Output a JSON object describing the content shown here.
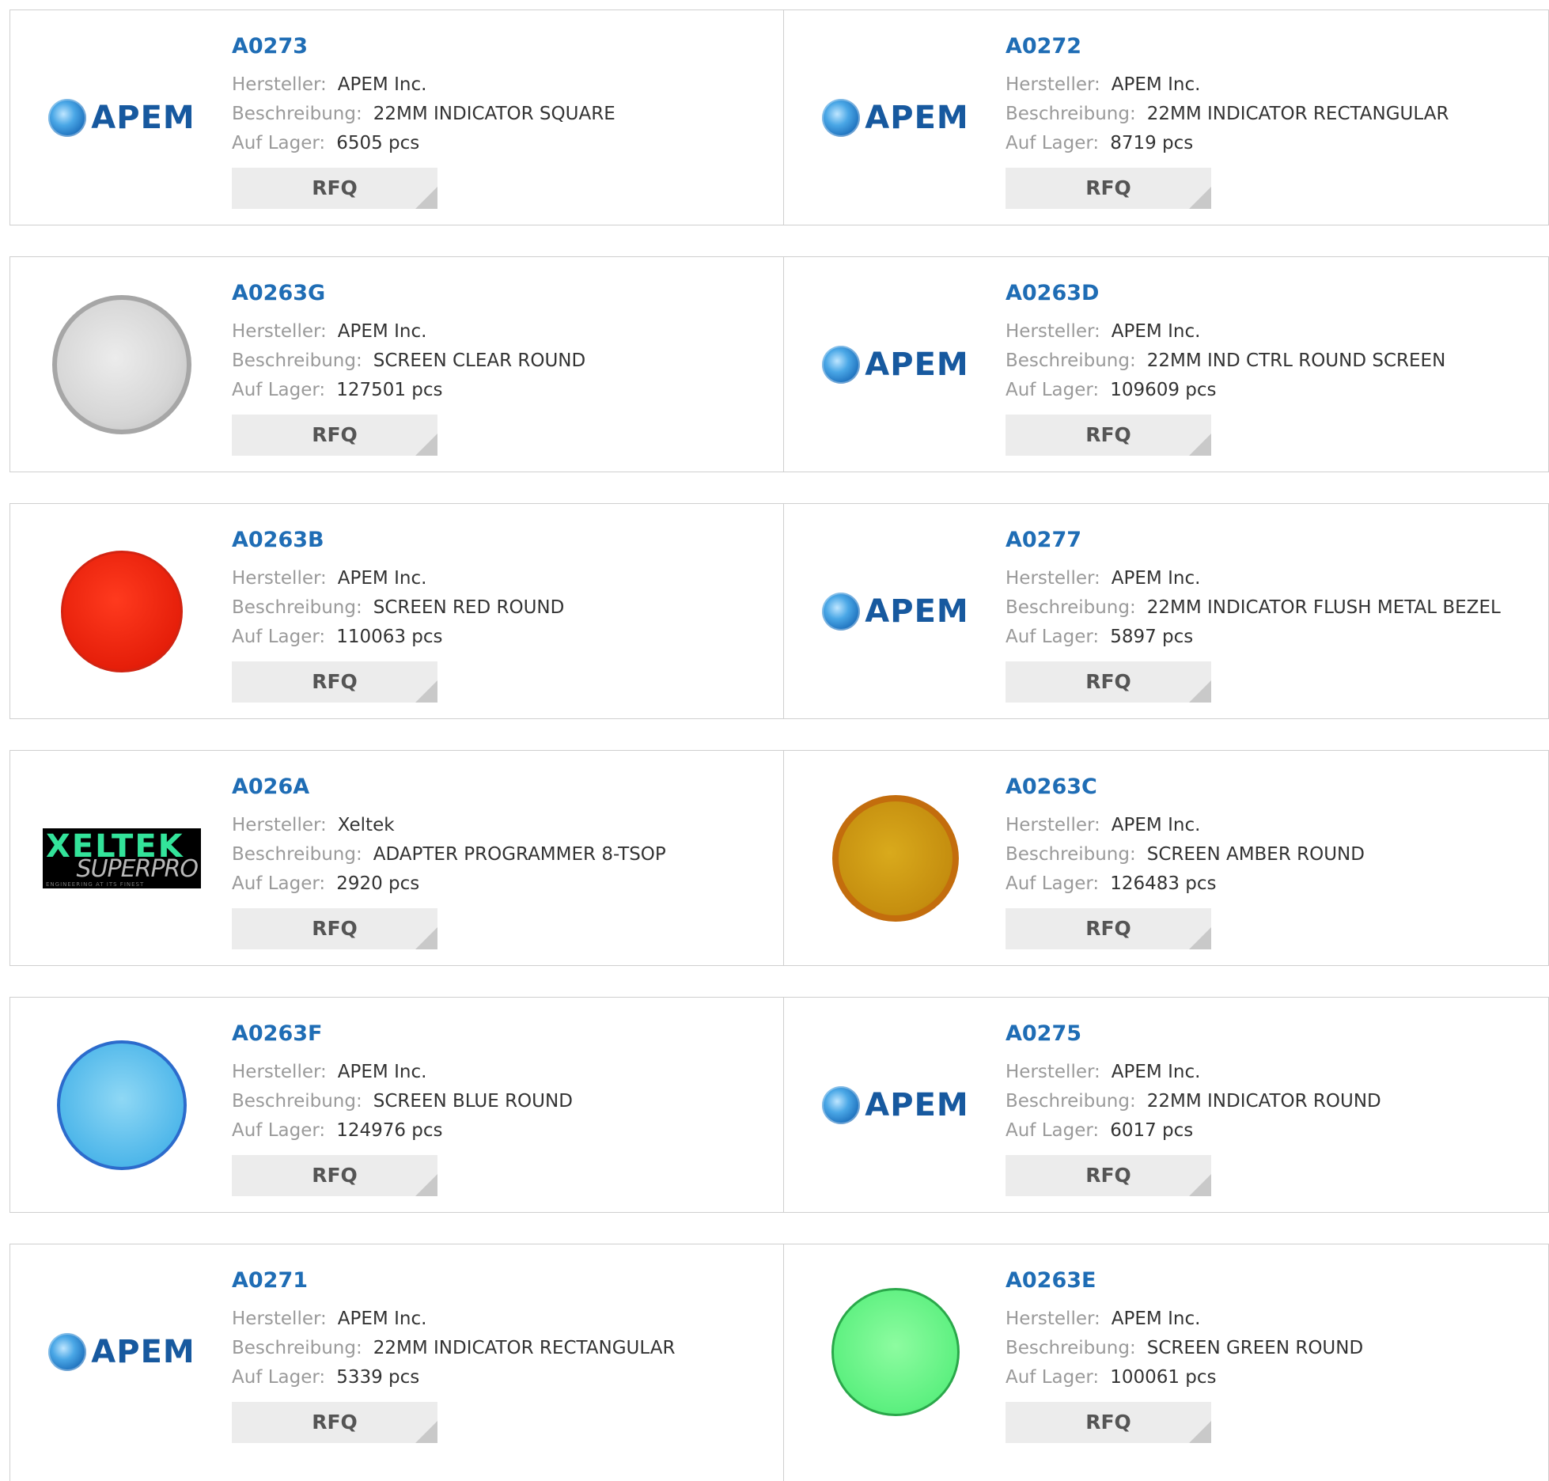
{
  "labels": {
    "manufacturer": "Hersteller:",
    "description": "Beschreibung:",
    "stock": "Auf Lager:",
    "rfq": "RFQ"
  },
  "brands": {
    "apem": "APEM",
    "xeltek_main": "XELTEK",
    "xeltek_sub": "SUPERPRO",
    "xeltek_tag": "ENGINEERING AT ITS FINEST"
  },
  "products": [
    {
      "part": "A0273",
      "manufacturer": "APEM Inc.",
      "description": "22MM INDICATOR SQUARE",
      "stock": "6505 pcs",
      "image": "apem-logo"
    },
    {
      "part": "A0272",
      "manufacturer": "APEM Inc.",
      "description": "22MM INDICATOR RECTANGULAR",
      "stock": "8719 pcs",
      "image": "apem-logo"
    },
    {
      "part": "A0263G",
      "manufacturer": "APEM Inc.",
      "description": "SCREEN CLEAR ROUND",
      "stock": "127501 pcs",
      "image": "clear-screen-photo"
    },
    {
      "part": "A0263D",
      "manufacturer": "APEM Inc.",
      "description": "22MM IND CTRL ROUND SCREEN",
      "stock": "109609 pcs",
      "image": "apem-logo"
    },
    {
      "part": "A0263B",
      "manufacturer": "APEM Inc.",
      "description": "SCREEN RED ROUND",
      "stock": "110063 pcs",
      "image": "red-screen-photo"
    },
    {
      "part": "A0277",
      "manufacturer": "APEM Inc.",
      "description": "22MM INDICATOR FLUSH METAL BEZEL",
      "stock": "5897 pcs",
      "image": "apem-logo"
    },
    {
      "part": "A026A",
      "manufacturer": "Xeltek",
      "description": "ADAPTER PROGRAMMER 8-TSOP",
      "stock": "2920 pcs",
      "image": "xeltek-logo"
    },
    {
      "part": "A0263C",
      "manufacturer": "APEM Inc.",
      "description": "SCREEN AMBER ROUND",
      "stock": "126483 pcs",
      "image": "amber-screen-photo"
    },
    {
      "part": "A0263F",
      "manufacturer": "APEM Inc.",
      "description": "SCREEN BLUE ROUND",
      "stock": "124976 pcs",
      "image": "blue-screen-photo"
    },
    {
      "part": "A0275",
      "manufacturer": "APEM Inc.",
      "description": "22MM INDICATOR ROUND",
      "stock": "6017 pcs",
      "image": "apem-logo"
    },
    {
      "part": "A0271",
      "manufacturer": "APEM Inc.",
      "description": "22MM INDICATOR RECTANGULAR",
      "stock": "5339 pcs",
      "image": "apem-logo"
    },
    {
      "part": "A0263E",
      "manufacturer": "APEM Inc.",
      "description": "SCREEN GREEN ROUND",
      "stock": "100061 pcs",
      "image": "green-screen-photo"
    }
  ],
  "colors": {
    "part_link": "#1f6db5",
    "label": "#9a9a9a",
    "value": "#333333",
    "rfq_bg": "#ececec",
    "border": "#cfcfcf"
  }
}
